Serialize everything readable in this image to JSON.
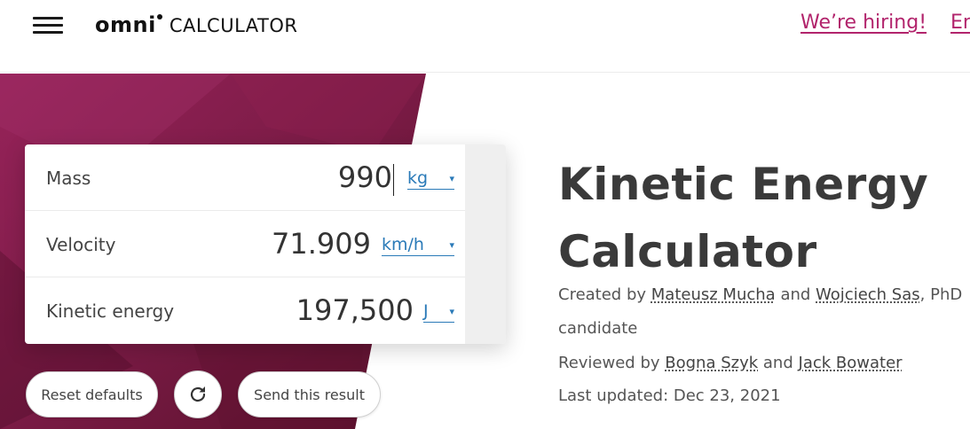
{
  "header": {
    "logo_main": "omni",
    "logo_sub": "CALCULATOR",
    "hiring_link": "We’re hiring!",
    "language_link": "En"
  },
  "calculator": {
    "rows": [
      {
        "label": "Mass",
        "value": "990",
        "unit": "kg"
      },
      {
        "label": "Velocity",
        "value": "71.909",
        "unit": "km/h"
      },
      {
        "label": "Kinetic energy",
        "value": "197,500",
        "unit": "J"
      }
    ],
    "unit_arrow": "▾"
  },
  "buttons": {
    "reset": "Reset defaults",
    "send": "Send this result"
  },
  "article": {
    "title_line1": "Kinetic Energy",
    "title_line2": "Calculator",
    "created_prefix": "Created by",
    "author1": "Mateusz Mucha",
    "and1": "and",
    "author2": "Wojciech Sas",
    "author2_suffix": ", PhD",
    "created_line2": "candidate",
    "reviewed_prefix": "Reviewed by",
    "reviewer1": "Bogna Szyk",
    "and2": "and",
    "reviewer2": "Jack Bowater",
    "updated": "Last updated: Dec 23, 2021"
  },
  "colors": {
    "brand": "#b2246c",
    "hero_dark": "#6e1838",
    "link_blue": "#2a7ab8"
  },
  "icons": {
    "menu": "hamburger-menu-icon",
    "reload": "reload-icon",
    "dropdown": "chevron-down-icon"
  }
}
